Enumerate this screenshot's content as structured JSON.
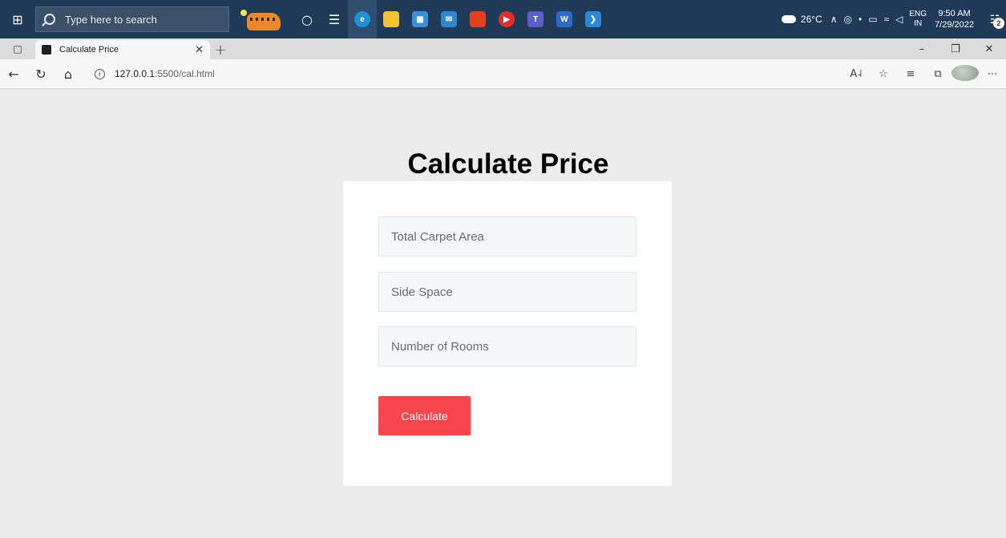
{
  "taskbar": {
    "search_placeholder": "Type here to search",
    "temperature": "26°C",
    "language_top": "ENG",
    "language_bottom": "IN",
    "time": "9:50 AM",
    "date": "7/29/2022",
    "notification_count": "2",
    "apps": [
      {
        "name": "edge-icon",
        "color": "#1f8fd6"
      },
      {
        "name": "file-explorer-icon",
        "color": "#f2c231"
      },
      {
        "name": "store-icon",
        "color": "#3a8fd9"
      },
      {
        "name": "mail-icon",
        "color": "#2f86d2"
      },
      {
        "name": "office-icon",
        "color": "#e2411c"
      },
      {
        "name": "youtube-music-icon",
        "color": "#e52d27"
      },
      {
        "name": "teams-icon",
        "color": "#5b5fc7"
      },
      {
        "name": "word-icon",
        "color": "#2b6ac9"
      },
      {
        "name": "vscode-icon",
        "color": "#2a8ad8"
      }
    ]
  },
  "browser": {
    "tab_title": "Calculate Price",
    "url_host": "127.0.0.1",
    "url_path": ":5500/cal.html"
  },
  "page": {
    "title": "Calculate Price",
    "fields": {
      "carpet_area_placeholder": "Total Carpet Area",
      "side_space_placeholder": "Side Space",
      "rooms_placeholder": "Number of Rooms"
    },
    "button_label": "Calculate",
    "accent_color": "#f7464d"
  }
}
